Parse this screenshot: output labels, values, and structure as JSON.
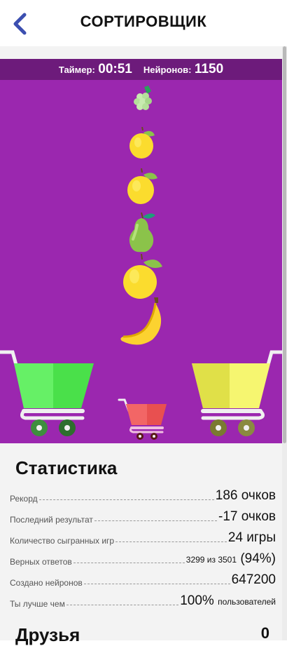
{
  "header": {
    "title": "СОРТИРОВЩИК"
  },
  "hud": {
    "timer_label": "Таймер:",
    "timer_value": "00:51",
    "neurons_label": "Нейронов:",
    "neurons_value": "1150"
  },
  "falling_items": [
    "grapes",
    "lemon",
    "lemon",
    "pear",
    "lemon",
    "banana"
  ],
  "carts": {
    "left_color": "#4ae04a",
    "right_color": "#f0f060",
    "small_color": "#e85050"
  },
  "stats": {
    "title": "Статистика",
    "rows": [
      {
        "label": "Рекорд",
        "value": "186 очков"
      },
      {
        "label": "Последний результат",
        "value": "-17 очков"
      },
      {
        "label": "Количество сыгранных игр",
        "value": "24 игры"
      },
      {
        "label": "Верных ответов",
        "value_small": "3299 из 3501",
        "value": "(94%)"
      },
      {
        "label": "Создано нейронов",
        "value": "647200"
      },
      {
        "label": "Ты лучше чем",
        "value": "100%",
        "value_small": "пользователей"
      }
    ]
  },
  "friends": {
    "label": "Друзья",
    "count": "0"
  },
  "colors": {
    "game_bg": "#9b27af",
    "hud_bg": "#6d1b7b",
    "accent": "#3c4fb0"
  }
}
